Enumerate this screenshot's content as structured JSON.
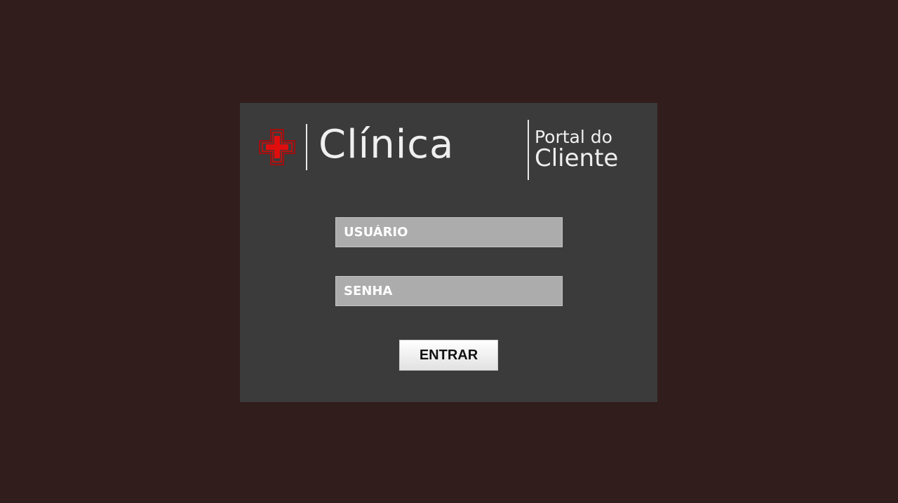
{
  "brand": {
    "icon": "medical-cross-icon",
    "name": "Clínica",
    "portal_line1": "Portal do",
    "portal_line2": "Cliente",
    "icon_color": "#d10f0f"
  },
  "form": {
    "username_placeholder": "USUÁRIO",
    "password_placeholder": "SENHA",
    "submit_label": "ENTRAR"
  },
  "colors": {
    "background": "#321d1d",
    "panel": "#3b3b3b",
    "field": "#acacac"
  }
}
